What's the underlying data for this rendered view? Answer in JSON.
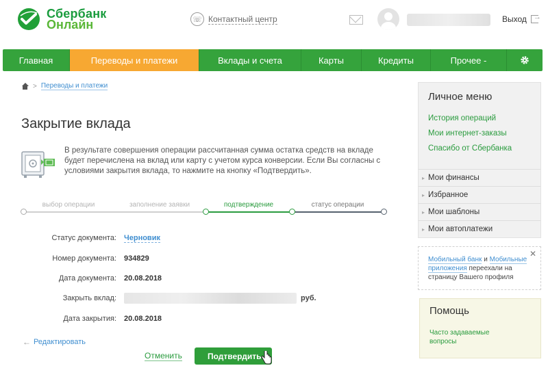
{
  "logo": {
    "line1": "Сбербанк",
    "line2": "Онлайн"
  },
  "header": {
    "contact_label": "Контактный центр",
    "logout_label": "Выход"
  },
  "nav": {
    "items": [
      {
        "label": "Главная",
        "active": false
      },
      {
        "label": "Переводы и платежи",
        "active": true
      },
      {
        "label": "Вклады и счета",
        "active": false
      },
      {
        "label": "Карты",
        "active": false
      },
      {
        "label": "Кредиты",
        "active": false
      },
      {
        "label": "Прочее -",
        "active": false
      }
    ]
  },
  "breadcrumb": {
    "link": "Переводы и платежи",
    "separator": ">"
  },
  "page": {
    "title": "Закрытие вклада",
    "info": "В результате совершения операции рассчитанная сумма остатка средств на вкладе будет перечислена на вклад или карту с учетом курса конверсии. Если Вы согласны с условиями закрытия вклада, то нажмите на кнопку «Подтвердить»."
  },
  "steps": [
    {
      "label": "выбор операции",
      "state": "done"
    },
    {
      "label": "заполнение заявки",
      "state": "done"
    },
    {
      "label": "подтверждение",
      "state": "active"
    },
    {
      "label": "статус операции",
      "state": "next"
    }
  ],
  "form": {
    "status_label": "Статус документа:",
    "status_value": "Черновик",
    "number_label": "Номер документа:",
    "number_value": "934829",
    "date_label": "Дата документа:",
    "date_value": "20.08.2018",
    "close_label": "Закрыть вклад:",
    "close_currency": "руб.",
    "closing_date_label": "Дата закрытия:",
    "closing_date_value": "20.08.2018"
  },
  "actions": {
    "edit": "Редактировать",
    "cancel": "Отменить",
    "confirm": "Подтвердить"
  },
  "side": {
    "title": "Личное меню",
    "links": [
      "История операций",
      "Мои интернет-заказы",
      "Спасибо от Сбербанка"
    ],
    "items": [
      "Мои финансы",
      "Избранное",
      "Мои шаблоны",
      "Мои автоплатежи"
    ]
  },
  "notice": {
    "link1": "Мобильный банк",
    "and": "и",
    "link2": "Мобильные приложения",
    "rest": "переехали на страницу Вашего профиля"
  },
  "help": {
    "title": "Помощь",
    "link": "Часто задаваемые вопросы"
  },
  "colors": {
    "green": "#35a33c",
    "orange": "#f7a832",
    "link": "#3f8ed0"
  },
  "icons": [
    "logo-icon",
    "phone-icon",
    "mail-icon",
    "avatar-icon",
    "logout-icon",
    "gear-icon",
    "home-icon",
    "safe-icon",
    "arrow-left-icon",
    "close-icon",
    "cursor-icon"
  ]
}
